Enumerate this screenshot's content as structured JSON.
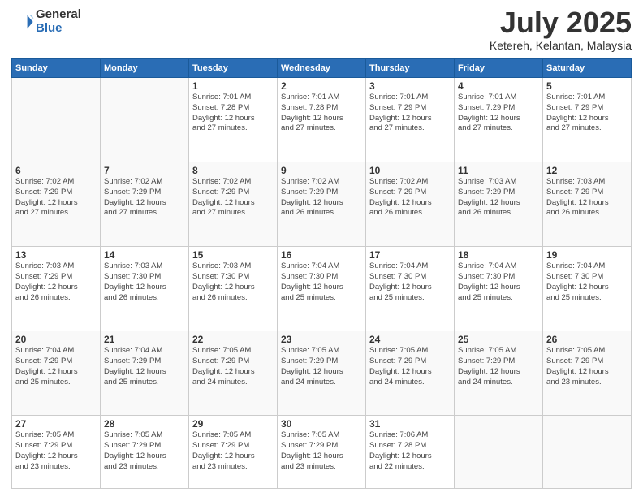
{
  "header": {
    "logo_general": "General",
    "logo_blue": "Blue",
    "month": "July 2025",
    "location": "Ketereh, Kelantan, Malaysia"
  },
  "weekdays": [
    "Sunday",
    "Monday",
    "Tuesday",
    "Wednesday",
    "Thursday",
    "Friday",
    "Saturday"
  ],
  "weeks": [
    [
      {
        "day": "",
        "detail": ""
      },
      {
        "day": "",
        "detail": ""
      },
      {
        "day": "1",
        "detail": "Sunrise: 7:01 AM\nSunset: 7:28 PM\nDaylight: 12 hours\nand 27 minutes."
      },
      {
        "day": "2",
        "detail": "Sunrise: 7:01 AM\nSunset: 7:28 PM\nDaylight: 12 hours\nand 27 minutes."
      },
      {
        "day": "3",
        "detail": "Sunrise: 7:01 AM\nSunset: 7:29 PM\nDaylight: 12 hours\nand 27 minutes."
      },
      {
        "day": "4",
        "detail": "Sunrise: 7:01 AM\nSunset: 7:29 PM\nDaylight: 12 hours\nand 27 minutes."
      },
      {
        "day": "5",
        "detail": "Sunrise: 7:01 AM\nSunset: 7:29 PM\nDaylight: 12 hours\nand 27 minutes."
      }
    ],
    [
      {
        "day": "6",
        "detail": "Sunrise: 7:02 AM\nSunset: 7:29 PM\nDaylight: 12 hours\nand 27 minutes."
      },
      {
        "day": "7",
        "detail": "Sunrise: 7:02 AM\nSunset: 7:29 PM\nDaylight: 12 hours\nand 27 minutes."
      },
      {
        "day": "8",
        "detail": "Sunrise: 7:02 AM\nSunset: 7:29 PM\nDaylight: 12 hours\nand 27 minutes."
      },
      {
        "day": "9",
        "detail": "Sunrise: 7:02 AM\nSunset: 7:29 PM\nDaylight: 12 hours\nand 26 minutes."
      },
      {
        "day": "10",
        "detail": "Sunrise: 7:02 AM\nSunset: 7:29 PM\nDaylight: 12 hours\nand 26 minutes."
      },
      {
        "day": "11",
        "detail": "Sunrise: 7:03 AM\nSunset: 7:29 PM\nDaylight: 12 hours\nand 26 minutes."
      },
      {
        "day": "12",
        "detail": "Sunrise: 7:03 AM\nSunset: 7:29 PM\nDaylight: 12 hours\nand 26 minutes."
      }
    ],
    [
      {
        "day": "13",
        "detail": "Sunrise: 7:03 AM\nSunset: 7:29 PM\nDaylight: 12 hours\nand 26 minutes."
      },
      {
        "day": "14",
        "detail": "Sunrise: 7:03 AM\nSunset: 7:30 PM\nDaylight: 12 hours\nand 26 minutes."
      },
      {
        "day": "15",
        "detail": "Sunrise: 7:03 AM\nSunset: 7:30 PM\nDaylight: 12 hours\nand 26 minutes."
      },
      {
        "day": "16",
        "detail": "Sunrise: 7:04 AM\nSunset: 7:30 PM\nDaylight: 12 hours\nand 25 minutes."
      },
      {
        "day": "17",
        "detail": "Sunrise: 7:04 AM\nSunset: 7:30 PM\nDaylight: 12 hours\nand 25 minutes."
      },
      {
        "day": "18",
        "detail": "Sunrise: 7:04 AM\nSunset: 7:30 PM\nDaylight: 12 hours\nand 25 minutes."
      },
      {
        "day": "19",
        "detail": "Sunrise: 7:04 AM\nSunset: 7:30 PM\nDaylight: 12 hours\nand 25 minutes."
      }
    ],
    [
      {
        "day": "20",
        "detail": "Sunrise: 7:04 AM\nSunset: 7:29 PM\nDaylight: 12 hours\nand 25 minutes."
      },
      {
        "day": "21",
        "detail": "Sunrise: 7:04 AM\nSunset: 7:29 PM\nDaylight: 12 hours\nand 25 minutes."
      },
      {
        "day": "22",
        "detail": "Sunrise: 7:05 AM\nSunset: 7:29 PM\nDaylight: 12 hours\nand 24 minutes."
      },
      {
        "day": "23",
        "detail": "Sunrise: 7:05 AM\nSunset: 7:29 PM\nDaylight: 12 hours\nand 24 minutes."
      },
      {
        "day": "24",
        "detail": "Sunrise: 7:05 AM\nSunset: 7:29 PM\nDaylight: 12 hours\nand 24 minutes."
      },
      {
        "day": "25",
        "detail": "Sunrise: 7:05 AM\nSunset: 7:29 PM\nDaylight: 12 hours\nand 24 minutes."
      },
      {
        "day": "26",
        "detail": "Sunrise: 7:05 AM\nSunset: 7:29 PM\nDaylight: 12 hours\nand 23 minutes."
      }
    ],
    [
      {
        "day": "27",
        "detail": "Sunrise: 7:05 AM\nSunset: 7:29 PM\nDaylight: 12 hours\nand 23 minutes."
      },
      {
        "day": "28",
        "detail": "Sunrise: 7:05 AM\nSunset: 7:29 PM\nDaylight: 12 hours\nand 23 minutes."
      },
      {
        "day": "29",
        "detail": "Sunrise: 7:05 AM\nSunset: 7:29 PM\nDaylight: 12 hours\nand 23 minutes."
      },
      {
        "day": "30",
        "detail": "Sunrise: 7:05 AM\nSunset: 7:29 PM\nDaylight: 12 hours\nand 23 minutes."
      },
      {
        "day": "31",
        "detail": "Sunrise: 7:06 AM\nSunset: 7:28 PM\nDaylight: 12 hours\nand 22 minutes."
      },
      {
        "day": "",
        "detail": ""
      },
      {
        "day": "",
        "detail": ""
      }
    ]
  ]
}
